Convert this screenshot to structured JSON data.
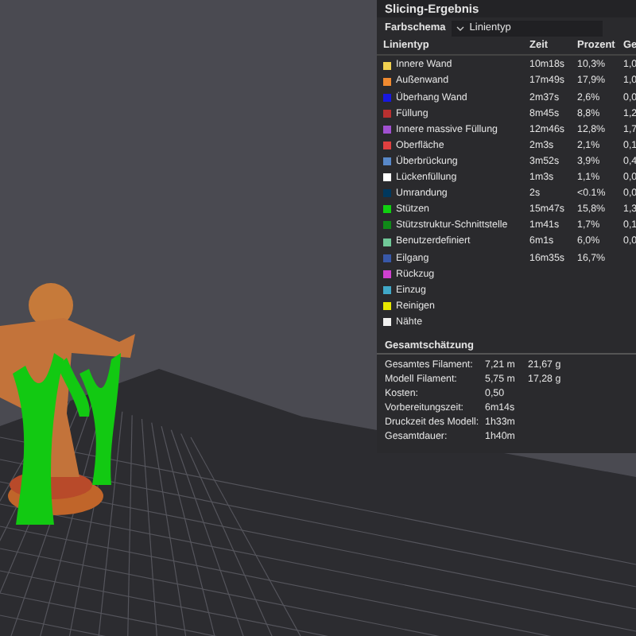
{
  "panel": {
    "title": "Slicing-Ergebnis",
    "color_scheme": {
      "label": "Farbschema",
      "value": "Linientyp"
    },
    "table": {
      "columns": [
        "Linientyp",
        "Zeit",
        "Prozent",
        "Ge"
      ],
      "rows": [
        {
          "name": "Innere Wand",
          "color": "#f0d050",
          "time": "10m18s",
          "percent": "10,3%",
          "column_4": "1,0"
        },
        {
          "name": "Außenwand",
          "color": "#f08a30",
          "time": "17m49s",
          "percent": "17,9%",
          "column_4": "1,0"
        },
        {
          "name": "Überhang Wand",
          "color": "#1818e0",
          "time": "2m37s",
          "percent": "2,6%",
          "column_4": "0,0"
        },
        {
          "name": "Füllung",
          "color": "#b83030",
          "time": "8m45s",
          "percent": "8,8%",
          "column_4": "1,2"
        },
        {
          "name": "Innere massive Füllung",
          "color": "#a050d0",
          "time": "12m46s",
          "percent": "12,8%",
          "column_4": "1,7"
        },
        {
          "name": "Oberfläche",
          "color": "#e04040",
          "time": "2m3s",
          "percent": "2,1%",
          "column_4": "0,1"
        },
        {
          "name": "Überbrückung",
          "color": "#5888c8",
          "time": "3m52s",
          "percent": "3,9%",
          "column_4": "0,4"
        },
        {
          "name": "Lückenfüllung",
          "color": "#ffffff",
          "time": "1m3s",
          "percent": "1,1%",
          "column_4": "0,0"
        },
        {
          "name": "Umrandung",
          "color": "#00385e",
          "time": "2s",
          "percent": "<0.1%",
          "column_4": "0,0"
        },
        {
          "name": "Stützen",
          "color": "#10d010",
          "time": "15m47s",
          "percent": "15,8%",
          "column_4": "1,3"
        },
        {
          "name": "Stützstruktur-Schnittstelle",
          "color": "#108a18",
          "time": "1m41s",
          "percent": "1,7%",
          "column_4": "0,1"
        },
        {
          "name": "Benutzerdefiniert",
          "color": "#70c898",
          "time": "6m1s",
          "percent": "6,0%",
          "column_4": "0,0"
        },
        {
          "name": "Eilgang",
          "color": "#3858a8",
          "time": "16m35s",
          "percent": "16,7%"
        },
        {
          "name": "Rückzug",
          "color": "#d040d0"
        },
        {
          "name": "Einzug",
          "color": "#40a8c8"
        },
        {
          "name": "Reinigen",
          "color": "#e8e800"
        },
        {
          "name": "Nähte",
          "color": "#f0f0f0"
        }
      ]
    },
    "summary": {
      "title": "Gesamtschätzung",
      "rows": [
        {
          "label": "Gesamtes Filament:",
          "value": "7,21 m",
          "value_2": "21,67 g"
        },
        {
          "label": "Modell Filament:",
          "value": "5,75 m",
          "value_2": "17,28 g"
        },
        {
          "label": "Kosten:",
          "value": "0,50"
        },
        {
          "label": "Vorbereitungszeit:",
          "value": "6m14s"
        },
        {
          "label": "Druckzeit des Modell:",
          "value": "1h33m"
        },
        {
          "label": "Gesamtdauer:",
          "value": "1h40m"
        }
      ]
    }
  }
}
